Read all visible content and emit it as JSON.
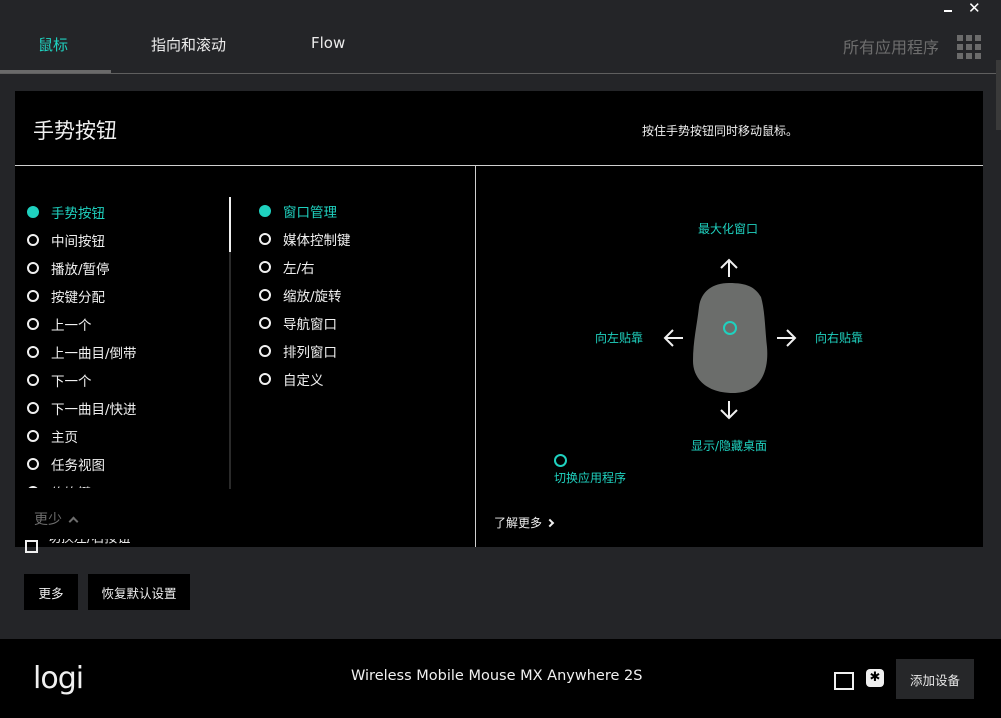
{
  "window": {
    "minimize_icon": "minimize-icon",
    "close_icon": "close-icon"
  },
  "tabs": [
    {
      "label": "鼠标",
      "active": true
    },
    {
      "label": "指向和滚动",
      "active": false
    },
    {
      "label": "Flow",
      "active": false
    }
  ],
  "all_apps": {
    "label": "所有应用程序",
    "icon": "grid-icon"
  },
  "panel": {
    "title": "手势按钮",
    "hint": "按住手势按钮同时移动鼠标。",
    "button_list": [
      {
        "label": "手势按钮",
        "selected": true
      },
      {
        "label": "中间按钮",
        "selected": false
      },
      {
        "label": "播放/暂停",
        "selected": false
      },
      {
        "label": "按键分配",
        "selected": false
      },
      {
        "label": "上一个",
        "selected": false
      },
      {
        "label": "上一曲目/倒带",
        "selected": false
      },
      {
        "label": "下一个",
        "selected": false
      },
      {
        "label": "下一曲目/快进",
        "selected": false
      },
      {
        "label": "主页",
        "selected": false
      },
      {
        "label": "任务视图",
        "selected": false
      },
      {
        "label": "修饰键",
        "selected": false
      }
    ],
    "gesture_list": [
      {
        "label": "窗口管理",
        "selected": true
      },
      {
        "label": "媒体控制键",
        "selected": false
      },
      {
        "label": "左/右",
        "selected": false
      },
      {
        "label": "缩放/旋转",
        "selected": false
      },
      {
        "label": "导航窗口",
        "selected": false
      },
      {
        "label": "排列窗口",
        "selected": false
      },
      {
        "label": "自定义",
        "selected": false
      }
    ],
    "less_label": "更少",
    "gesture_actions": {
      "up": "最大化窗口",
      "left": "向左贴靠",
      "right": "向右贴靠",
      "down": "显示/隐藏桌面",
      "click": "切换应用程序"
    },
    "learn_more": "了解更多",
    "accent_color": "#1fd1bf"
  },
  "below_panel": {
    "swap_buttons_label": "切换左/右按钮",
    "swap_buttons_checked": false,
    "more_button": "更多",
    "reset_button": "恢复默认设置"
  },
  "footer": {
    "logo": "logi",
    "device_name": "Wireless Mobile Mouse MX Anywhere 2S",
    "add_device": "添加设备"
  }
}
